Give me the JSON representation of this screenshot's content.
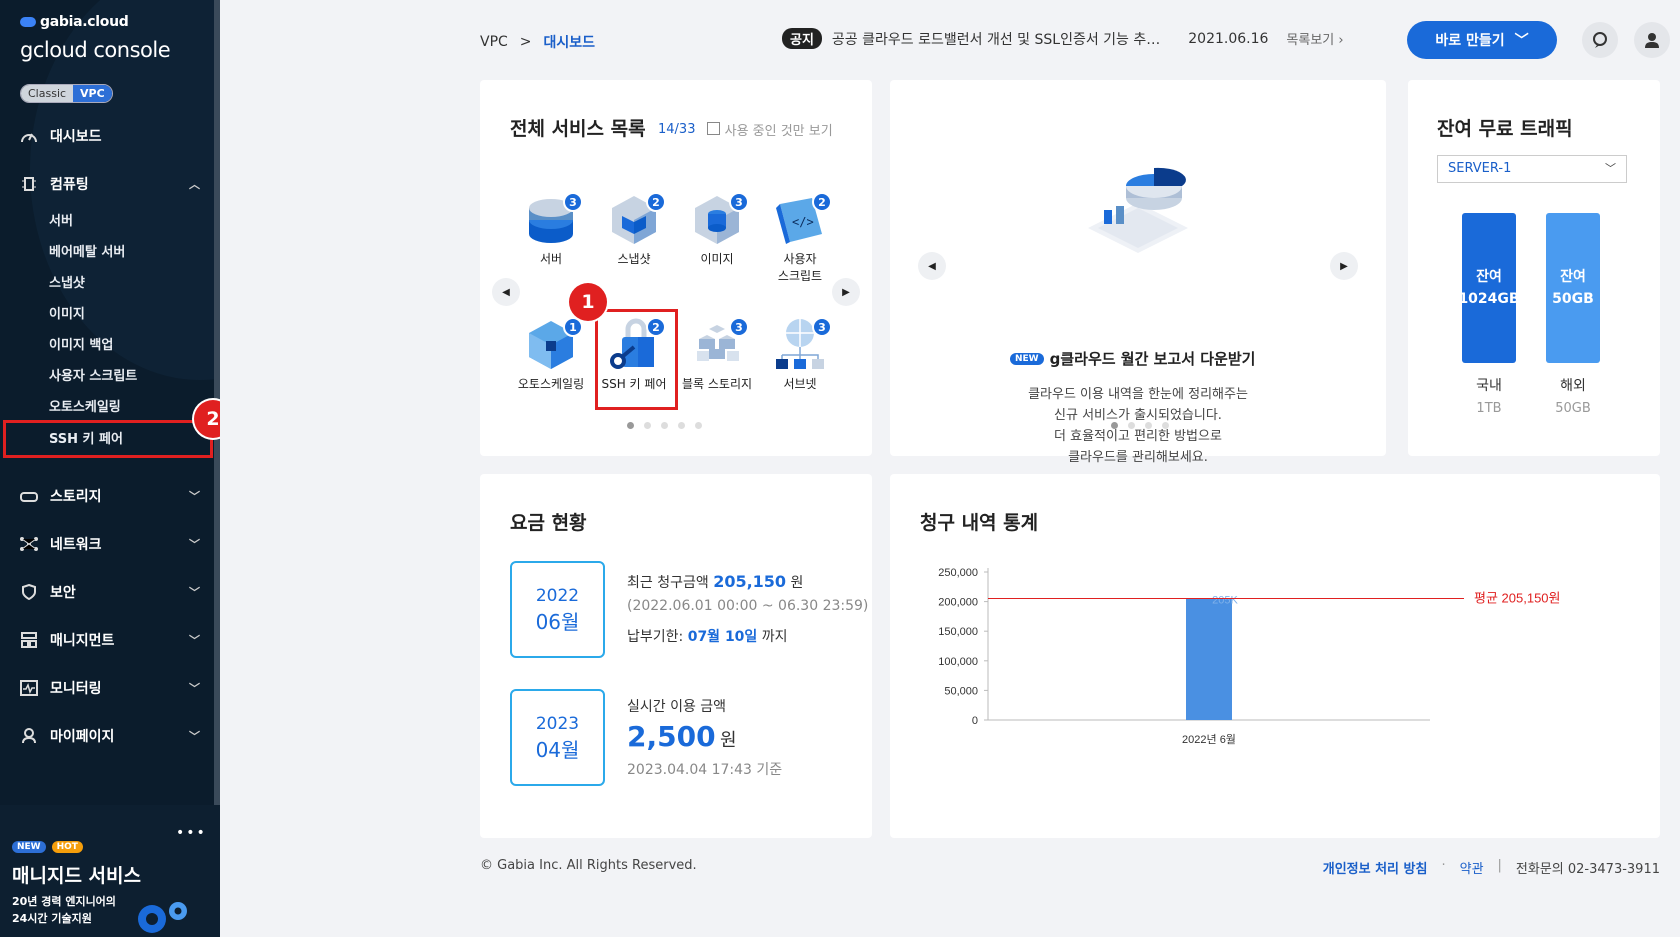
{
  "sidebar": {
    "brand_top": "gabia.cloud",
    "brand": "gcloud console",
    "toggle": {
      "classic": "Classic",
      "vpc": "VPC"
    },
    "dashboard": "대시보드",
    "computing": "컴퓨팅",
    "computing_items": [
      "서버",
      "베어메탈 서버",
      "스냅샷",
      "이미지",
      "이미지 백업",
      "사용자 스크립트",
      "오토스케일링",
      "SSH 키 페어"
    ],
    "menus": [
      "스토리지",
      "네트워크",
      "보안",
      "매니지먼트",
      "모니터링",
      "마이페이지"
    ],
    "annotation_2": "2",
    "promo": {
      "new": "NEW",
      "hot": "HOT",
      "title": "매니지드 서비스",
      "sub1": "20년 경력 엔지니어의",
      "sub2": "24시간 기술지원",
      "dots": "•••"
    }
  },
  "topbar": {
    "breadcrumb": [
      "VPC",
      "대시보드"
    ],
    "breadcrumb_sep": ">",
    "notice_label": "공지",
    "notice_text": "공공 클라우드 로드밸런서 개선 및 SSL인증서 기능 추…",
    "notice_date": "2021.06.16",
    "notice_more": "목록보기",
    "create_button": "바로 만들기"
  },
  "services": {
    "title": "전체 서비스 목록",
    "count": "14/33",
    "filter_label": "사용 중인 것만 보기",
    "annotation_1": "1",
    "items": [
      {
        "label": "서버",
        "count": "3"
      },
      {
        "label": "스냅샷",
        "count": "2"
      },
      {
        "label": "이미지",
        "count": "3"
      },
      {
        "label": "사용자",
        "label2": "스크립트",
        "count": "2"
      },
      {
        "label": "오토스케일링",
        "count": "1"
      },
      {
        "label": "SSH 키 페어",
        "count": "2"
      },
      {
        "label": "블록 스토리지",
        "count": "3"
      },
      {
        "label": "서브넷",
        "count": "3"
      }
    ]
  },
  "banner": {
    "new": "NEW",
    "title": "g클라우드 월간 보고서 다운받기",
    "desc": [
      "클라우드 이용 내역을 한눈에 정리해주는",
      "신규 서비스가 출시되었습니다.",
      "더 효율적이고 편리한 방법으로",
      "클라우드를 관리해보세요."
    ]
  },
  "traffic": {
    "title": "잔여 무료 트래픽",
    "server": "SERVER-1",
    "domestic": {
      "remain_label": "잔여",
      "remain": "1024GB",
      "region": "국내",
      "quota": "1TB",
      "color": "#1a6ad9"
    },
    "overseas": {
      "remain_label": "잔여",
      "remain": "50GB",
      "region": "해외",
      "quota": "50GB",
      "color": "#4a9bf0"
    }
  },
  "billing": {
    "title": "요금 현황",
    "recent": {
      "year": "2022",
      "month": "06월",
      "label": "최근 청구금액",
      "amount": "205,150",
      "unit": "원",
      "period": "(2022.06.01 00:00 ~ 06.30 23:59)",
      "due_label": "납부기한:",
      "due": "07월 10일",
      "due_suffix": "까지"
    },
    "realtime": {
      "year": "2023",
      "month": "04월",
      "label": "실시간 이용 금액",
      "amount": "2,500",
      "unit": "원",
      "asof": "2023.04.04 17:43 기준"
    }
  },
  "chart_title": "청구 내역 통계",
  "chart_data": {
    "type": "bar",
    "categories": [
      "2022년 6월"
    ],
    "values": [
      205150
    ],
    "data_labels": [
      "205K"
    ],
    "ylim": [
      0,
      250000
    ],
    "yticks": [
      "250,000",
      "200,000",
      "150,000",
      "100,000",
      "50,000",
      "0"
    ],
    "average_line": {
      "value": 205150,
      "label": "평균 205,150원",
      "color": "#e02020"
    },
    "bar_color": "#4a90e2"
  },
  "footer": {
    "copyright": "© Gabia Inc. All Rights Reserved.",
    "privacy": "개인정보 처리 방침",
    "terms": "약관",
    "contact": "전화문의 02-3473-3911"
  }
}
